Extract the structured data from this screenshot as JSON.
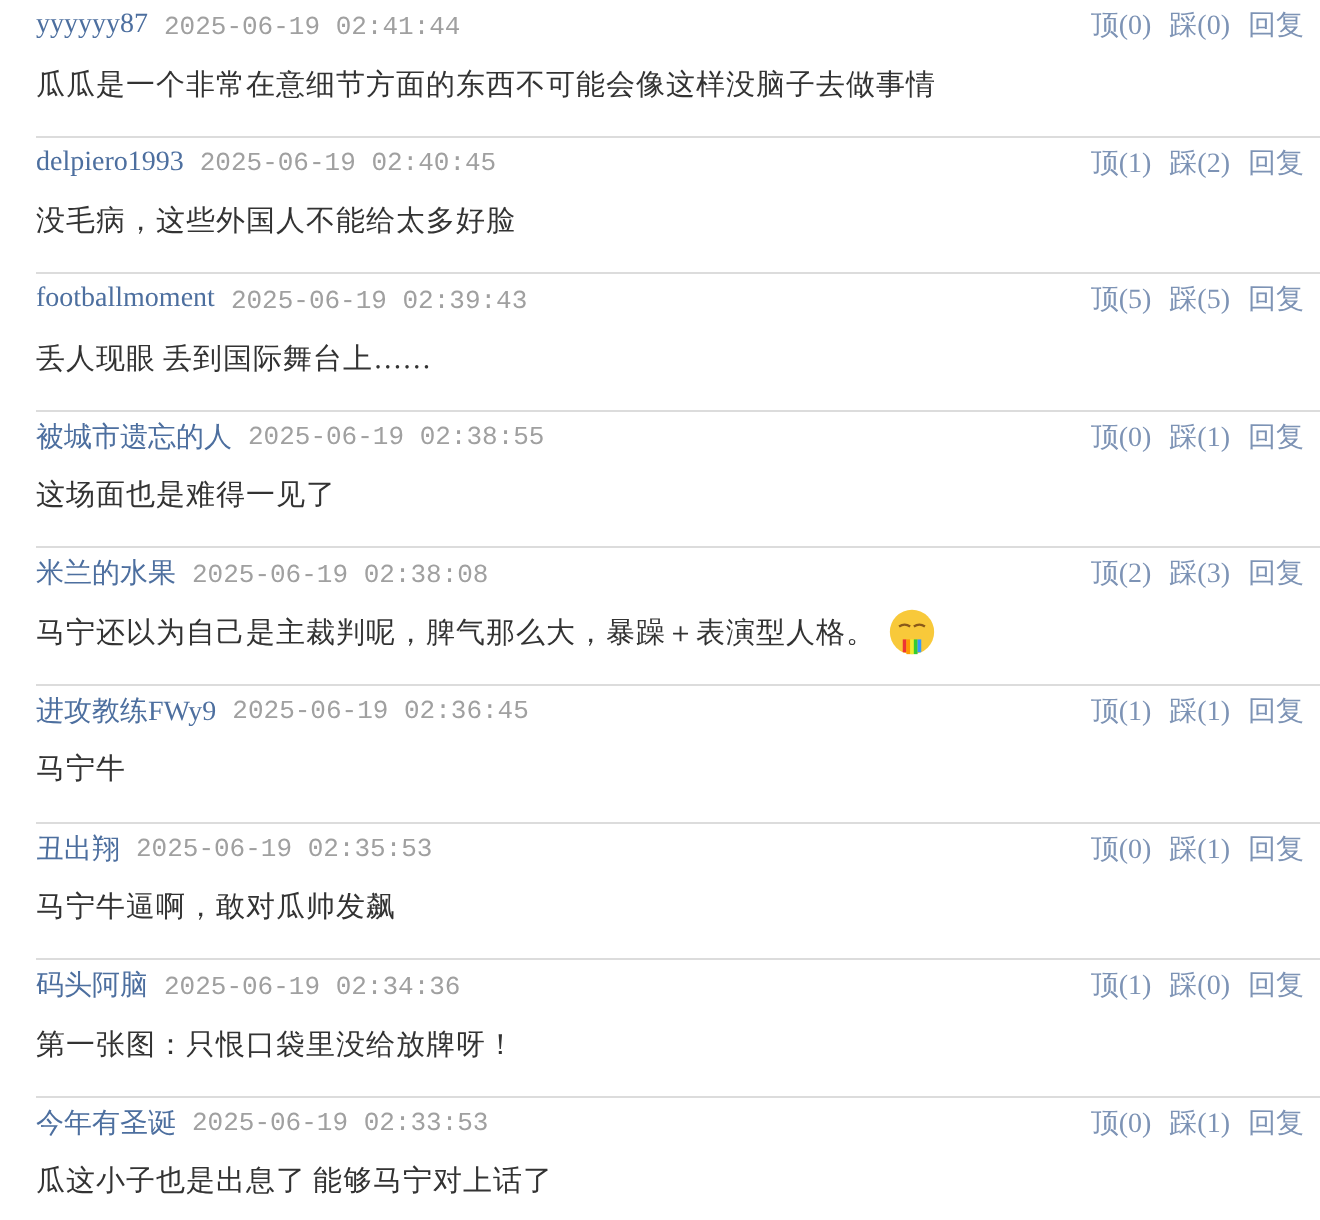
{
  "comments": [
    {
      "user": "yyyyyy87",
      "time": "2025-06-19 02:41:44",
      "up": "顶(0)",
      "down": "踩(0)",
      "reply": "回复",
      "text": "瓜瓜是一个非常在意细节方面的东西不可能会像这样没脑子去做事情",
      "emoji": false
    },
    {
      "user": "delpiero1993",
      "time": "2025-06-19 02:40:45",
      "up": "顶(1)",
      "down": "踩(2)",
      "reply": "回复",
      "text": "没毛病，这些外国人不能给太多好脸",
      "emoji": false
    },
    {
      "user": "footballmoment",
      "time": "2025-06-19 02:39:43",
      "up": "顶(5)",
      "down": "踩(5)",
      "reply": "回复",
      "text": "丢人现眼 丢到国际舞台上……",
      "emoji": false
    },
    {
      "user": "被城市遗忘的人",
      "time": "2025-06-19 02:38:55",
      "up": "顶(0)",
      "down": "踩(1)",
      "reply": "回复",
      "text": "这场面也是难得一见了",
      "emoji": false
    },
    {
      "user": "米兰的水果",
      "time": "2025-06-19 02:38:08",
      "up": "顶(2)",
      "down": "踩(3)",
      "reply": "回复",
      "text": "马宁还以为自己是主裁判呢，脾气那么大，暴躁＋表演型人格。",
      "emoji": true
    },
    {
      "user": "进攻教练FWy9",
      "time": "2025-06-19 02:36:45",
      "up": "顶(1)",
      "down": "踩(1)",
      "reply": "回复",
      "text": "马宁牛",
      "emoji": false
    },
    {
      "user": "丑出翔",
      "time": "2025-06-19 02:35:53",
      "up": "顶(0)",
      "down": "踩(1)",
      "reply": "回复",
      "text": "马宁牛逼啊，敢对瓜帅发飙",
      "emoji": false
    },
    {
      "user": "码头阿脑",
      "time": "2025-06-19 02:34:36",
      "up": "顶(1)",
      "down": "踩(0)",
      "reply": "回复",
      "text": "第一张图：只恨口袋里没给放牌呀！",
      "emoji": false
    },
    {
      "user": "今年有圣诞",
      "time": "2025-06-19 02:33:53",
      "up": "顶(0)",
      "down": "踩(1)",
      "reply": "回复",
      "text": "瓜这小子也是出息了 能够马宁对上话了",
      "emoji": false
    }
  ]
}
